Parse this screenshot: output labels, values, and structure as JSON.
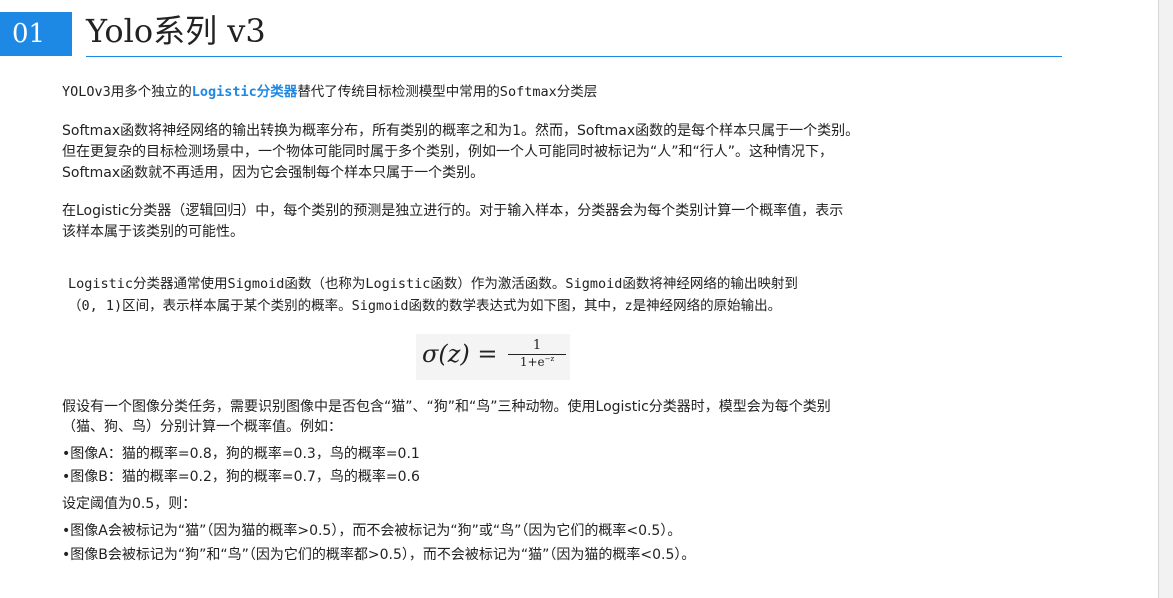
{
  "header": {
    "number": "01",
    "title": "Yolo系列 v3"
  },
  "intro": {
    "prefix": "YOLOv3用多个独立的",
    "highlight": "Logistic分类器",
    "suffix": "替代了传统目标检测模型中常用的Softmax分类层"
  },
  "softmax": {
    "line1": "Softmax函数将神经网络的输出转换为概率分布，所有类别的概率之和为1。然而，Softmax函数的是每个样本只属于一个类别。",
    "line2": "但在更复杂的目标检测场景中，一个物体可能同时属于多个类别，例如一个人可能同时被标记为“人”和“行人”。这种情况下，",
    "line3": "Softmax函数就不再适用，因为它会强制每个样本只属于一个类别。"
  },
  "logistic": {
    "line1": "在Logistic分类器（逻辑回归）中，每个类别的预测是独立进行的。对于输入样本，分类器会为每个类别计算一个概率值，表示",
    "line2": "该样本属于该类别的可能性。"
  },
  "sigmoid": {
    "line1": "Logistic分类器通常使用Sigmoid函数（也称为Logistic函数）作为激活函数。Sigmoid函数将神经网络的输出映射到",
    "line2": "（0, 1)区间，表示样本属于某个类别的概率。Sigmoid函数的数学表达式为如下图，其中，z是神经网络的原始输出。"
  },
  "formula": {
    "lhs": "σ(z) =",
    "numerator": "1",
    "denominator": "1+e",
    "exponent": "−z"
  },
  "example": {
    "line1": "假设有一个图像分类任务，需要识别图像中是否包含“猫”、“狗”和“鸟”三种动物。使用Logistic分类器时，模型会为每个类别",
    "line2": "（猫、狗、鸟）分别计算一个概率值。例如：",
    "bulletA": "•图像A：猫的概率=0.8，狗的概率=0.3，鸟的概率=0.1",
    "bulletB": "•图像B：猫的概率=0.2，狗的概率=0.7，鸟的概率=0.6",
    "threshold": "设定阈值为0.5，则：",
    "resultA": "•图像A会被标记为“猫”（因为猫的概率>0.5），而不会被标记为“狗”或“鸟”（因为它们的概率<0.5）。",
    "resultB": "•图像B会被标记为“狗”和“鸟”（因为它们的概率都>0.5），而不会被标记为“猫”（因为猫的概率<0.5）。"
  }
}
